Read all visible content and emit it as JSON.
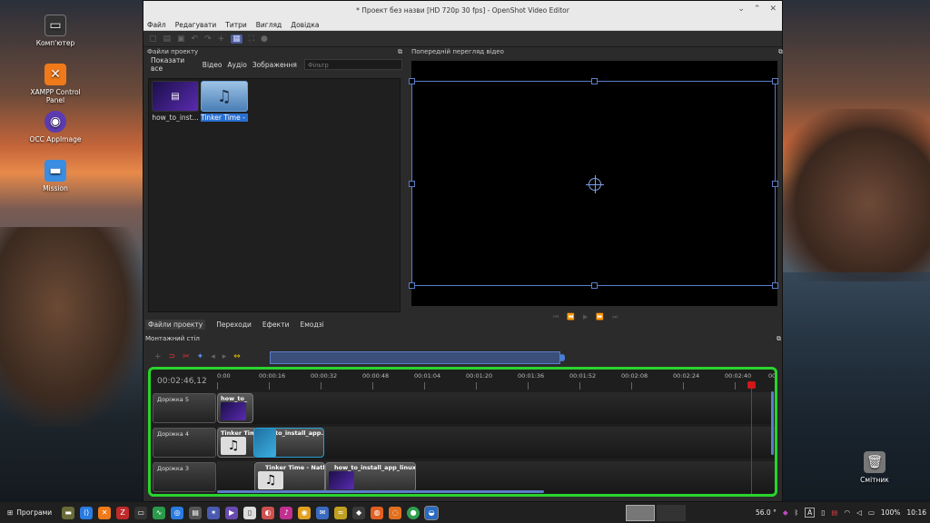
{
  "desktop": {
    "icons": [
      {
        "label": "Комп'ютер",
        "icon": "computer-icon"
      },
      {
        "label": "XAMPP Control Panel",
        "icon": "xampp-icon"
      },
      {
        "label": "OCC AppImage",
        "icon": "appimage-icon"
      },
      {
        "label": "Mission",
        "icon": "folder-icon"
      }
    ],
    "trash_label": "Смітник"
  },
  "window": {
    "title": "* Проект без назви [HD 720p 30 fps] - OpenShot Video Editor",
    "menu": [
      "Файл",
      "Редагувати",
      "Титри",
      "Вигляд",
      "Довідка"
    ]
  },
  "files_panel": {
    "title": "Файли проекту",
    "filters": [
      "Показати все",
      "Відео",
      "Аудіо",
      "Зображення"
    ],
    "filter_placeholder": "Фільтр",
    "files": [
      {
        "name": "how_to_inst...",
        "type": "video"
      },
      {
        "name": "Tinker Time - ...",
        "type": "audio",
        "selected": true
      }
    ]
  },
  "preview_panel": {
    "title": "Попередній перегляд відео"
  },
  "bottom_tabs": [
    "Файли проекту",
    "Переходи",
    "Ефекти",
    "Емодзі"
  ],
  "timeline": {
    "title": "Монтажний стіл",
    "timecode": "00:02:46,12",
    "ruler": [
      "0:00",
      "00:00:16",
      "00:00:32",
      "00:00:48",
      "00:01:04",
      "00:01:20",
      "00:01:36",
      "00:01:52",
      "00:02:08",
      "00:02:24",
      "00:02:40",
      "00"
    ],
    "tracks": [
      {
        "name": "Доріжка 5",
        "clips": [
          {
            "label": "how_to_",
            "kind": "video"
          }
        ]
      },
      {
        "name": "Доріжка 4",
        "clips": [
          {
            "label": "Tinker Tim",
            "kind": "audio"
          },
          {
            "label": "to_install_app...",
            "kind": "video"
          }
        ]
      },
      {
        "name": "Доріжка 3",
        "clips": [
          {
            "label": "Tinker Time - Nathan",
            "kind": "audio"
          },
          {
            "label": "how_to_install_app_linux-2...",
            "kind": "video"
          }
        ]
      }
    ]
  },
  "taskbar": {
    "start_label": "Програми",
    "temperature": "56.0 °",
    "battery": "100%",
    "clock": "10:16",
    "keyboard_layout": "A"
  }
}
